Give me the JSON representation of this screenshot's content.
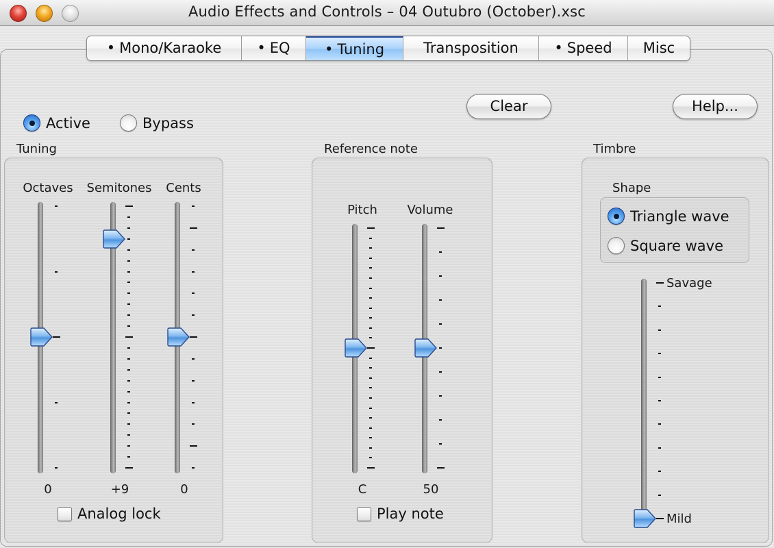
{
  "window": {
    "title": "Audio Effects and Controls – 04 Outubro (October).xsc",
    "controls": [
      "close",
      "minimize",
      "zoom"
    ]
  },
  "tabs": [
    {
      "label": "Mono/Karaoke",
      "bullet": true,
      "selected": false
    },
    {
      "label": "EQ",
      "bullet": true,
      "selected": false
    },
    {
      "label": "Tuning",
      "bullet": true,
      "selected": true
    },
    {
      "label": "Transposition",
      "bullet": false,
      "selected": false
    },
    {
      "label": "Speed",
      "bullet": true,
      "selected": false
    },
    {
      "label": "Misc",
      "bullet": false,
      "selected": false
    }
  ],
  "mode": {
    "options": [
      {
        "label": "Active",
        "selected": true
      },
      {
        "label": "Bypass",
        "selected": false
      }
    ]
  },
  "buttons": {
    "clear": "Clear",
    "help": "Help..."
  },
  "tuning": {
    "label": "Tuning",
    "sliders": [
      {
        "label": "Octaves",
        "value_text": "0",
        "min": -2,
        "max": 2,
        "value": 0,
        "ticks": 5,
        "major_ticks": [
          2
        ]
      },
      {
        "label": "Semitones",
        "value_text": "+9",
        "min": -12,
        "max": 12,
        "value": 9,
        "ticks": 25,
        "major_ticks": [
          0,
          12,
          24
        ]
      },
      {
        "label": "Cents",
        "value_text": "0",
        "min": -60,
        "max": 60,
        "value": 0,
        "ticks": 13,
        "major_ticks": [
          1,
          6,
          11
        ]
      }
    ],
    "analog_lock": {
      "label": "Analog lock",
      "checked": false
    }
  },
  "reference_note": {
    "label": "Reference note",
    "sliders": [
      {
        "label": "Pitch",
        "value_text": "C",
        "min": -12,
        "max": 12,
        "value": 0,
        "ticks": 25,
        "major_ticks": [
          0,
          12,
          24
        ]
      },
      {
        "label": "Volume",
        "value_text": "50",
        "min": 0,
        "max": 100,
        "value": 50,
        "ticks": 11,
        "major_ticks": [
          0,
          10
        ]
      }
    ],
    "play_note": {
      "label": "Play note",
      "checked": false
    }
  },
  "timbre": {
    "label": "Timbre",
    "shape_label": "Shape",
    "shapes": [
      {
        "label": "Triangle wave",
        "selected": true
      },
      {
        "label": "Square wave",
        "selected": false
      }
    ],
    "slider": {
      "min": 0,
      "max": 10,
      "value": 0,
      "ticks": 11,
      "top_label": "Savage",
      "bottom_label": "Mild"
    }
  }
}
